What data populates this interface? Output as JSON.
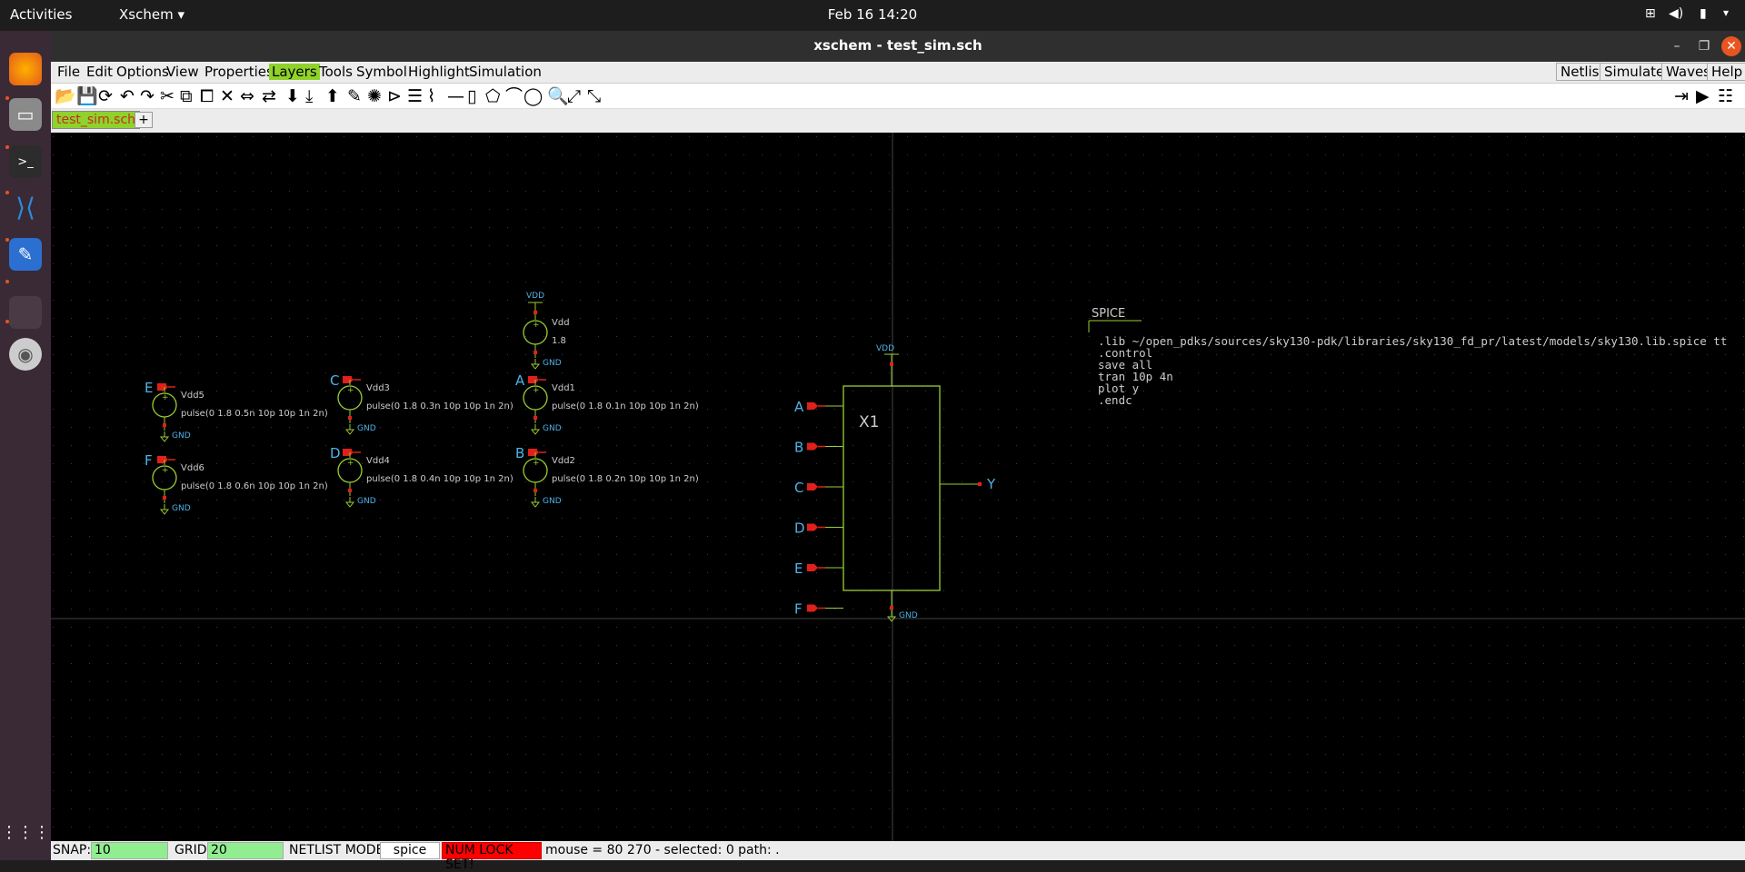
{
  "topbar": {
    "activities": "Activities",
    "app": "Xschem ▾",
    "clock": "Feb 16  14:20"
  },
  "window": {
    "title": "xschem - test_sim.sch"
  },
  "menu": [
    "File",
    "Edit",
    "Options",
    "View",
    "Properties",
    "Layers",
    "Tools",
    "Symbol",
    "Highlight",
    "Simulation"
  ],
  "menu_right": [
    "Netlist",
    "Simulate",
    "Waves",
    "Help"
  ],
  "tabs": {
    "active": "test_sim.sch",
    "add": "+"
  },
  "schematic": {
    "vdd_label": "VDD",
    "gnd_label": "GND",
    "main_source": {
      "name": "Vdd",
      "value": "1.8"
    },
    "sources": [
      {
        "pin": "E",
        "name": "Vdd5",
        "value": "pulse(0 1.8 0.5n 10p 10p 1n 2n)"
      },
      {
        "pin": "F",
        "name": "Vdd6",
        "value": "pulse(0 1.8 0.6n 10p 10p 1n 2n)"
      },
      {
        "pin": "C",
        "name": "Vdd3",
        "value": "pulse(0 1.8 0.3n 10p 10p 1n 2n)"
      },
      {
        "pin": "D",
        "name": "Vdd4",
        "value": "pulse(0 1.8 0.4n 10p 10p 1n 2n)"
      },
      {
        "pin": "A",
        "name": "Vdd1",
        "value": "pulse(0 1.8 0.1n 10p 10p 1n 2n)"
      },
      {
        "pin": "B",
        "name": "Vdd2",
        "value": "pulse(0 1.8 0.2n 10p 10p 1n 2n)"
      }
    ],
    "block": {
      "name": "X1",
      "inputs": [
        "A",
        "B",
        "C",
        "D",
        "E",
        "F"
      ],
      "output": "Y"
    },
    "spice": {
      "title": "SPICE",
      "lines": [
        ".lib ~/open_pdks/sources/sky130-pdk/libraries/sky130_fd_pr/latest/models/sky130.lib.spice tt",
        ".control",
        "save all",
        "tran 10p 4n",
        "plot y",
        ".endc"
      ]
    }
  },
  "status": {
    "snap_label": "SNAP:",
    "snap": "10",
    "grid_label": "GRID:",
    "grid": "20",
    "netlist_label": "NETLIST MODE:",
    "netlist_mode": "spice",
    "numlock": "NUM LOCK SET!",
    "mouse": "mouse = 80 270 - selected: 0 path: ."
  },
  "colors": {
    "wire": "#9acd32",
    "pin": "#e0201a",
    "net": "#4db3e8",
    "text": "#cccccc",
    "tab": "#8fd22b",
    "status_field": "#90ee90",
    "numlock": "#ff0000"
  }
}
